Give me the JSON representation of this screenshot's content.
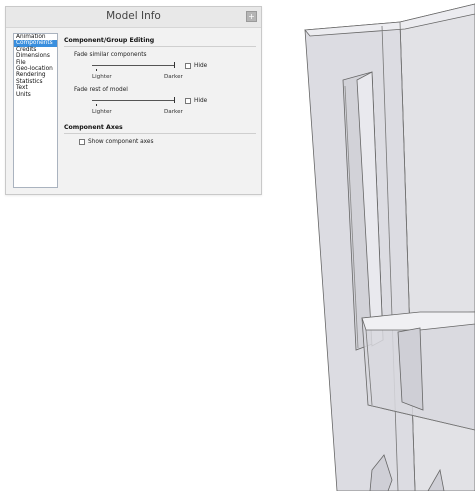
{
  "dialog": {
    "title": "Model Info",
    "expand_glyph": "+",
    "categories": [
      "Animation",
      "Components",
      "Credits",
      "Dimensions",
      "File",
      "Geo-location",
      "Rendering",
      "Statistics",
      "Text",
      "Units"
    ],
    "selected_category": "Components"
  },
  "panel": {
    "group_editing": {
      "title": "Component/Group Editing",
      "fade_similar": {
        "label": "Fade similar components",
        "lighter": "Lighter",
        "darker": "Darker",
        "hide_label": "Hide",
        "hide_checked": false,
        "level": 1.0
      },
      "fade_rest": {
        "label": "Fade rest of model",
        "lighter": "Lighter",
        "darker": "Darker",
        "hide_label": "Hide",
        "hide_checked": false,
        "level": 1.0
      }
    },
    "component_axes": {
      "title": "Component Axes",
      "show_axes_label": "Show component axes",
      "show_axes_checked": false
    }
  },
  "icons": [
    "expand-icon"
  ],
  "colors": {
    "selection": "#3a8fde",
    "dialog_bg": "#f2f2f2",
    "model_face": "#e6e6ea"
  }
}
